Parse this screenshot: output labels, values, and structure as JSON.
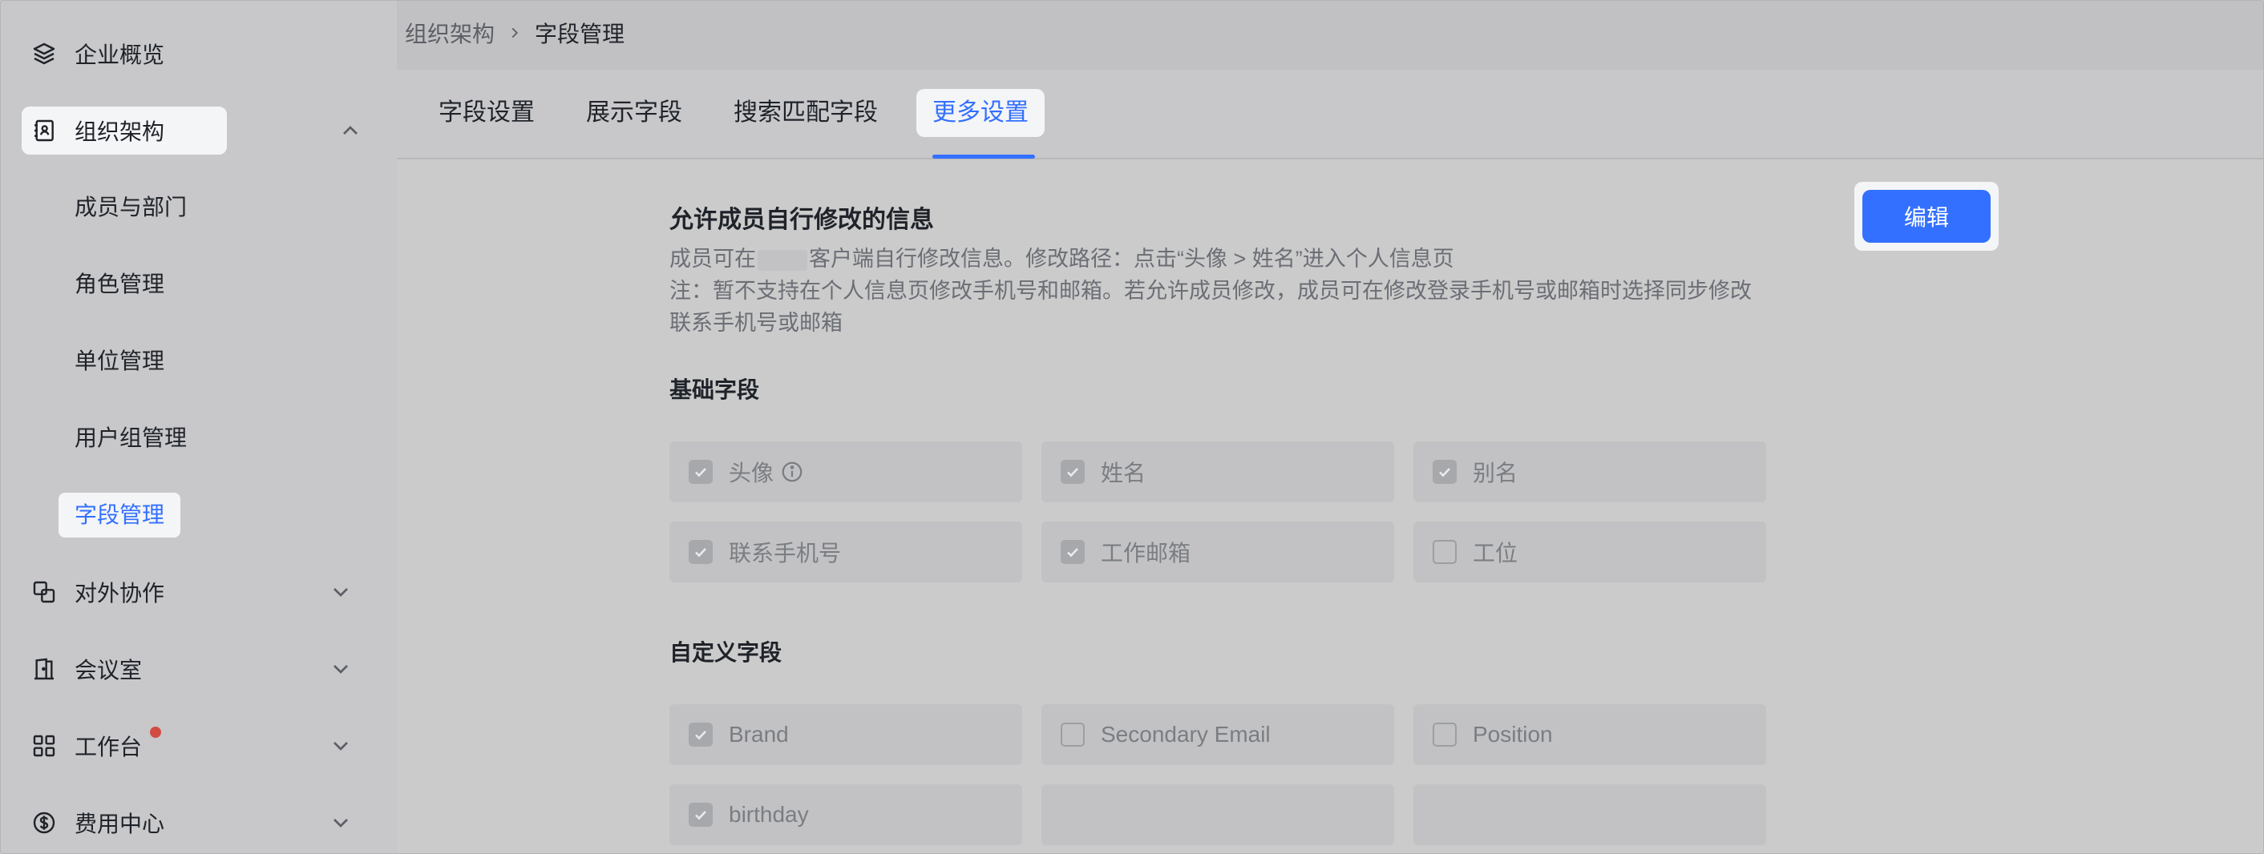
{
  "sidebar": {
    "items": [
      {
        "label": "企业概览",
        "icon": "layers-icon"
      },
      {
        "label": "组织架构",
        "icon": "contact-book-icon",
        "expanded": true
      },
      {
        "label": "对外协作",
        "icon": "external-collab-icon"
      },
      {
        "label": "会议室",
        "icon": "door-icon"
      },
      {
        "label": "工作台",
        "icon": "grid-icon",
        "badge": true
      },
      {
        "label": "费用中心",
        "icon": "dollar-icon"
      }
    ],
    "subitems": [
      {
        "label": "成员与部门"
      },
      {
        "label": "角色管理"
      },
      {
        "label": "单位管理"
      },
      {
        "label": "用户组管理"
      },
      {
        "label": "字段管理",
        "active": true
      }
    ]
  },
  "breadcrumb": [
    "组织架构",
    "字段管理"
  ],
  "tabs": [
    {
      "label": "字段设置"
    },
    {
      "label": "展示字段"
    },
    {
      "label": "搜索匹配字段"
    },
    {
      "label": "更多设置",
      "active": true
    }
  ],
  "section": {
    "title": "允许成员自行修改的信息",
    "desc1_pre": "成员可在",
    "desc1_post": "客户端自行修改信息。修改路径：点击“头像 > 姓名”进入个人信息页",
    "desc2": "注：暂不支持在个人信息页修改手机号和邮箱。若允许成员修改，成员可在修改登录手机号或邮箱时选择同步修改",
    "desc3": "联系手机号或邮箱",
    "edit_label": "编辑"
  },
  "basic": {
    "title": "基础字段",
    "fields": [
      {
        "label": "头像",
        "checked": true,
        "info": true
      },
      {
        "label": "姓名",
        "checked": true
      },
      {
        "label": "别名",
        "checked": true
      },
      {
        "label": "联系手机号",
        "checked": true
      },
      {
        "label": "工作邮箱",
        "checked": true
      },
      {
        "label": "工位",
        "checked": false
      }
    ]
  },
  "custom": {
    "title": "自定义字段",
    "fields": [
      {
        "label": "Brand",
        "checked": true
      },
      {
        "label": "Secondary Email",
        "checked": false
      },
      {
        "label": "Position",
        "checked": false
      },
      {
        "label": "birthday",
        "checked": true
      }
    ]
  },
  "colors": {
    "accent": "#3370ff",
    "badge": "#d14c43"
  }
}
